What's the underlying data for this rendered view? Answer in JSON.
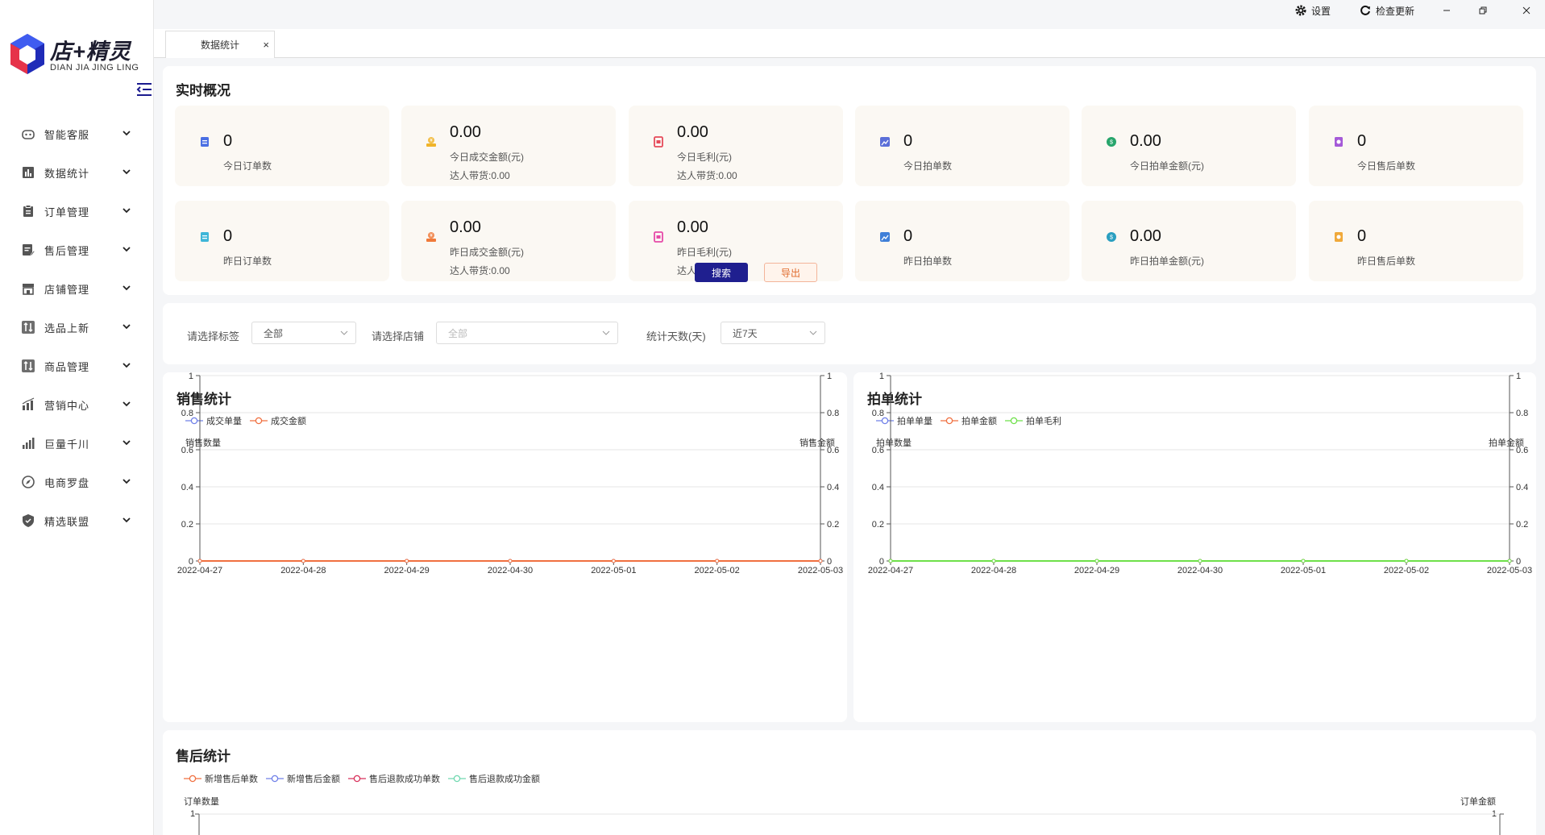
{
  "app": {
    "name": "店+精灵",
    "pinyin": "DIAN JIA JING LING"
  },
  "topbar": {
    "settings_label": "设置",
    "update_label": "检查更新"
  },
  "tabs": [
    {
      "label": "数据统计",
      "close": "×"
    }
  ],
  "sidebar": {
    "items": [
      {
        "label": "智能客服",
        "icon": "robot-icon"
      },
      {
        "label": "数据统计",
        "icon": "bar-chart-icon"
      },
      {
        "label": "订单管理",
        "icon": "clipboard-icon"
      },
      {
        "label": "售后管理",
        "icon": "edit-doc-icon"
      },
      {
        "label": "店铺管理",
        "icon": "store-icon"
      },
      {
        "label": "选品上新",
        "icon": "sort-icon"
      },
      {
        "label": "商品管理",
        "icon": "sort-icon"
      },
      {
        "label": "营销中心",
        "icon": "chart-icon"
      },
      {
        "label": "巨量千川",
        "icon": "signal-icon"
      },
      {
        "label": "电商罗盘",
        "icon": "compass-icon"
      },
      {
        "label": "精选联盟",
        "icon": "shield-icon"
      }
    ]
  },
  "overview": {
    "title": "实时概况",
    "stats": [
      {
        "value": "0",
        "label": "今日订单数",
        "extra": "",
        "color": "#4a6fe3",
        "icon": "order-icon"
      },
      {
        "value": "0.00",
        "label": "今日成交金额(元)",
        "extra": "达人带货:0.00",
        "color": "#f0b429",
        "icon": "money-icon"
      },
      {
        "value": "0.00",
        "label": "今日毛利(元)",
        "extra": "达人带货:0.00",
        "color": "#e64a5a",
        "icon": "profit-icon"
      },
      {
        "value": "0",
        "label": "今日拍单数",
        "extra": "",
        "color": "#5b6fd8",
        "icon": "photo-icon"
      },
      {
        "value": "0.00",
        "label": "今日拍单金额(元)",
        "extra": "",
        "color": "#27a56b",
        "icon": "coin-icon"
      },
      {
        "value": "0",
        "label": "今日售后单数",
        "extra": "",
        "color": "#a55ad8",
        "icon": "aftersale-icon"
      },
      {
        "value": "0",
        "label": "昨日订单数",
        "extra": "",
        "color": "#3fb6d8",
        "icon": "order-icon"
      },
      {
        "value": "0.00",
        "label": "昨日成交金额(元)",
        "extra": "达人带货:0.00",
        "color": "#f07a3a",
        "icon": "money-icon"
      },
      {
        "value": "0.00",
        "label": "昨日毛利(元)",
        "extra": "达人带货:0.00",
        "color": "#e64aa8",
        "icon": "profit-icon"
      },
      {
        "value": "0",
        "label": "昨日拍单数",
        "extra": "",
        "color": "#3f7fd8",
        "icon": "photo-icon"
      },
      {
        "value": "0.00",
        "label": "昨日拍单金额(元)",
        "extra": "",
        "color": "#2a9fc0",
        "icon": "coin-icon"
      },
      {
        "value": "0",
        "label": "昨日售后单数",
        "extra": "",
        "color": "#f0a93a",
        "icon": "aftersale-icon"
      }
    ]
  },
  "filters": {
    "tag_label": "请选择标签",
    "tag_value": "全部",
    "shop_label": "请选择店铺",
    "shop_value": "全部",
    "days_label": "统计天数(天)",
    "days_value": "近7天",
    "search_label": "搜索",
    "export_label": "导出"
  },
  "sales_chart": {
    "title": "销售统计"
  },
  "order_chart": {
    "title": "拍单统计"
  },
  "after_chart": {
    "title": "售后统计",
    "legend": [
      {
        "name": "新增售后单数",
        "color": "#f07040"
      },
      {
        "name": "新增售后金额",
        "color": "#7080e8"
      },
      {
        "name": "售后退款成功单数",
        "color": "#d8305a"
      },
      {
        "name": "售后退款成功金额",
        "color": "#70d8b0"
      }
    ],
    "ylabel_left": "订单数量",
    "ylabel_right": "订单金额",
    "ytick_top": "1"
  },
  "chart_data": [
    {
      "type": "line",
      "title": "销售统计",
      "x": [
        "2022-04-27",
        "2022-04-28",
        "2022-04-29",
        "2022-04-30",
        "2022-05-01",
        "2022-05-02",
        "2022-05-03"
      ],
      "series": [
        {
          "name": "成交单量",
          "color": "#7080e8",
          "values": [
            0,
            0,
            0,
            0,
            0,
            0,
            0
          ]
        },
        {
          "name": "成交金额",
          "color": "#f07040",
          "values": [
            0,
            0,
            0,
            0,
            0,
            0,
            0
          ]
        }
      ],
      "ylabel": "销售数量",
      "ylabel_right": "销售金额",
      "ylim": [
        0,
        1
      ],
      "yticks": [
        "0",
        "0.2",
        "0.4",
        "0.6",
        "0.8",
        "1"
      ],
      "grid": true,
      "legend_position": "top-left"
    },
    {
      "type": "line",
      "title": "拍单统计",
      "x": [
        "2022-04-27",
        "2022-04-28",
        "2022-04-29",
        "2022-04-30",
        "2022-05-01",
        "2022-05-02",
        "2022-05-03"
      ],
      "series": [
        {
          "name": "拍单单量",
          "color": "#7080e8",
          "values": [
            0,
            0,
            0,
            0,
            0,
            0,
            0
          ]
        },
        {
          "name": "拍单金额",
          "color": "#f07040",
          "values": [
            0,
            0,
            0,
            0,
            0,
            0,
            0
          ]
        },
        {
          "name": "拍单毛利",
          "color": "#6ee04a",
          "values": [
            0,
            0,
            0,
            0,
            0,
            0,
            0
          ]
        }
      ],
      "ylabel": "拍单数量",
      "ylabel_right": "拍单金额",
      "ylim": [
        0,
        1
      ],
      "yticks": [
        "0",
        "0.2",
        "0.4",
        "0.6",
        "0.8",
        "1"
      ],
      "grid": true,
      "legend_position": "top-left"
    }
  ]
}
